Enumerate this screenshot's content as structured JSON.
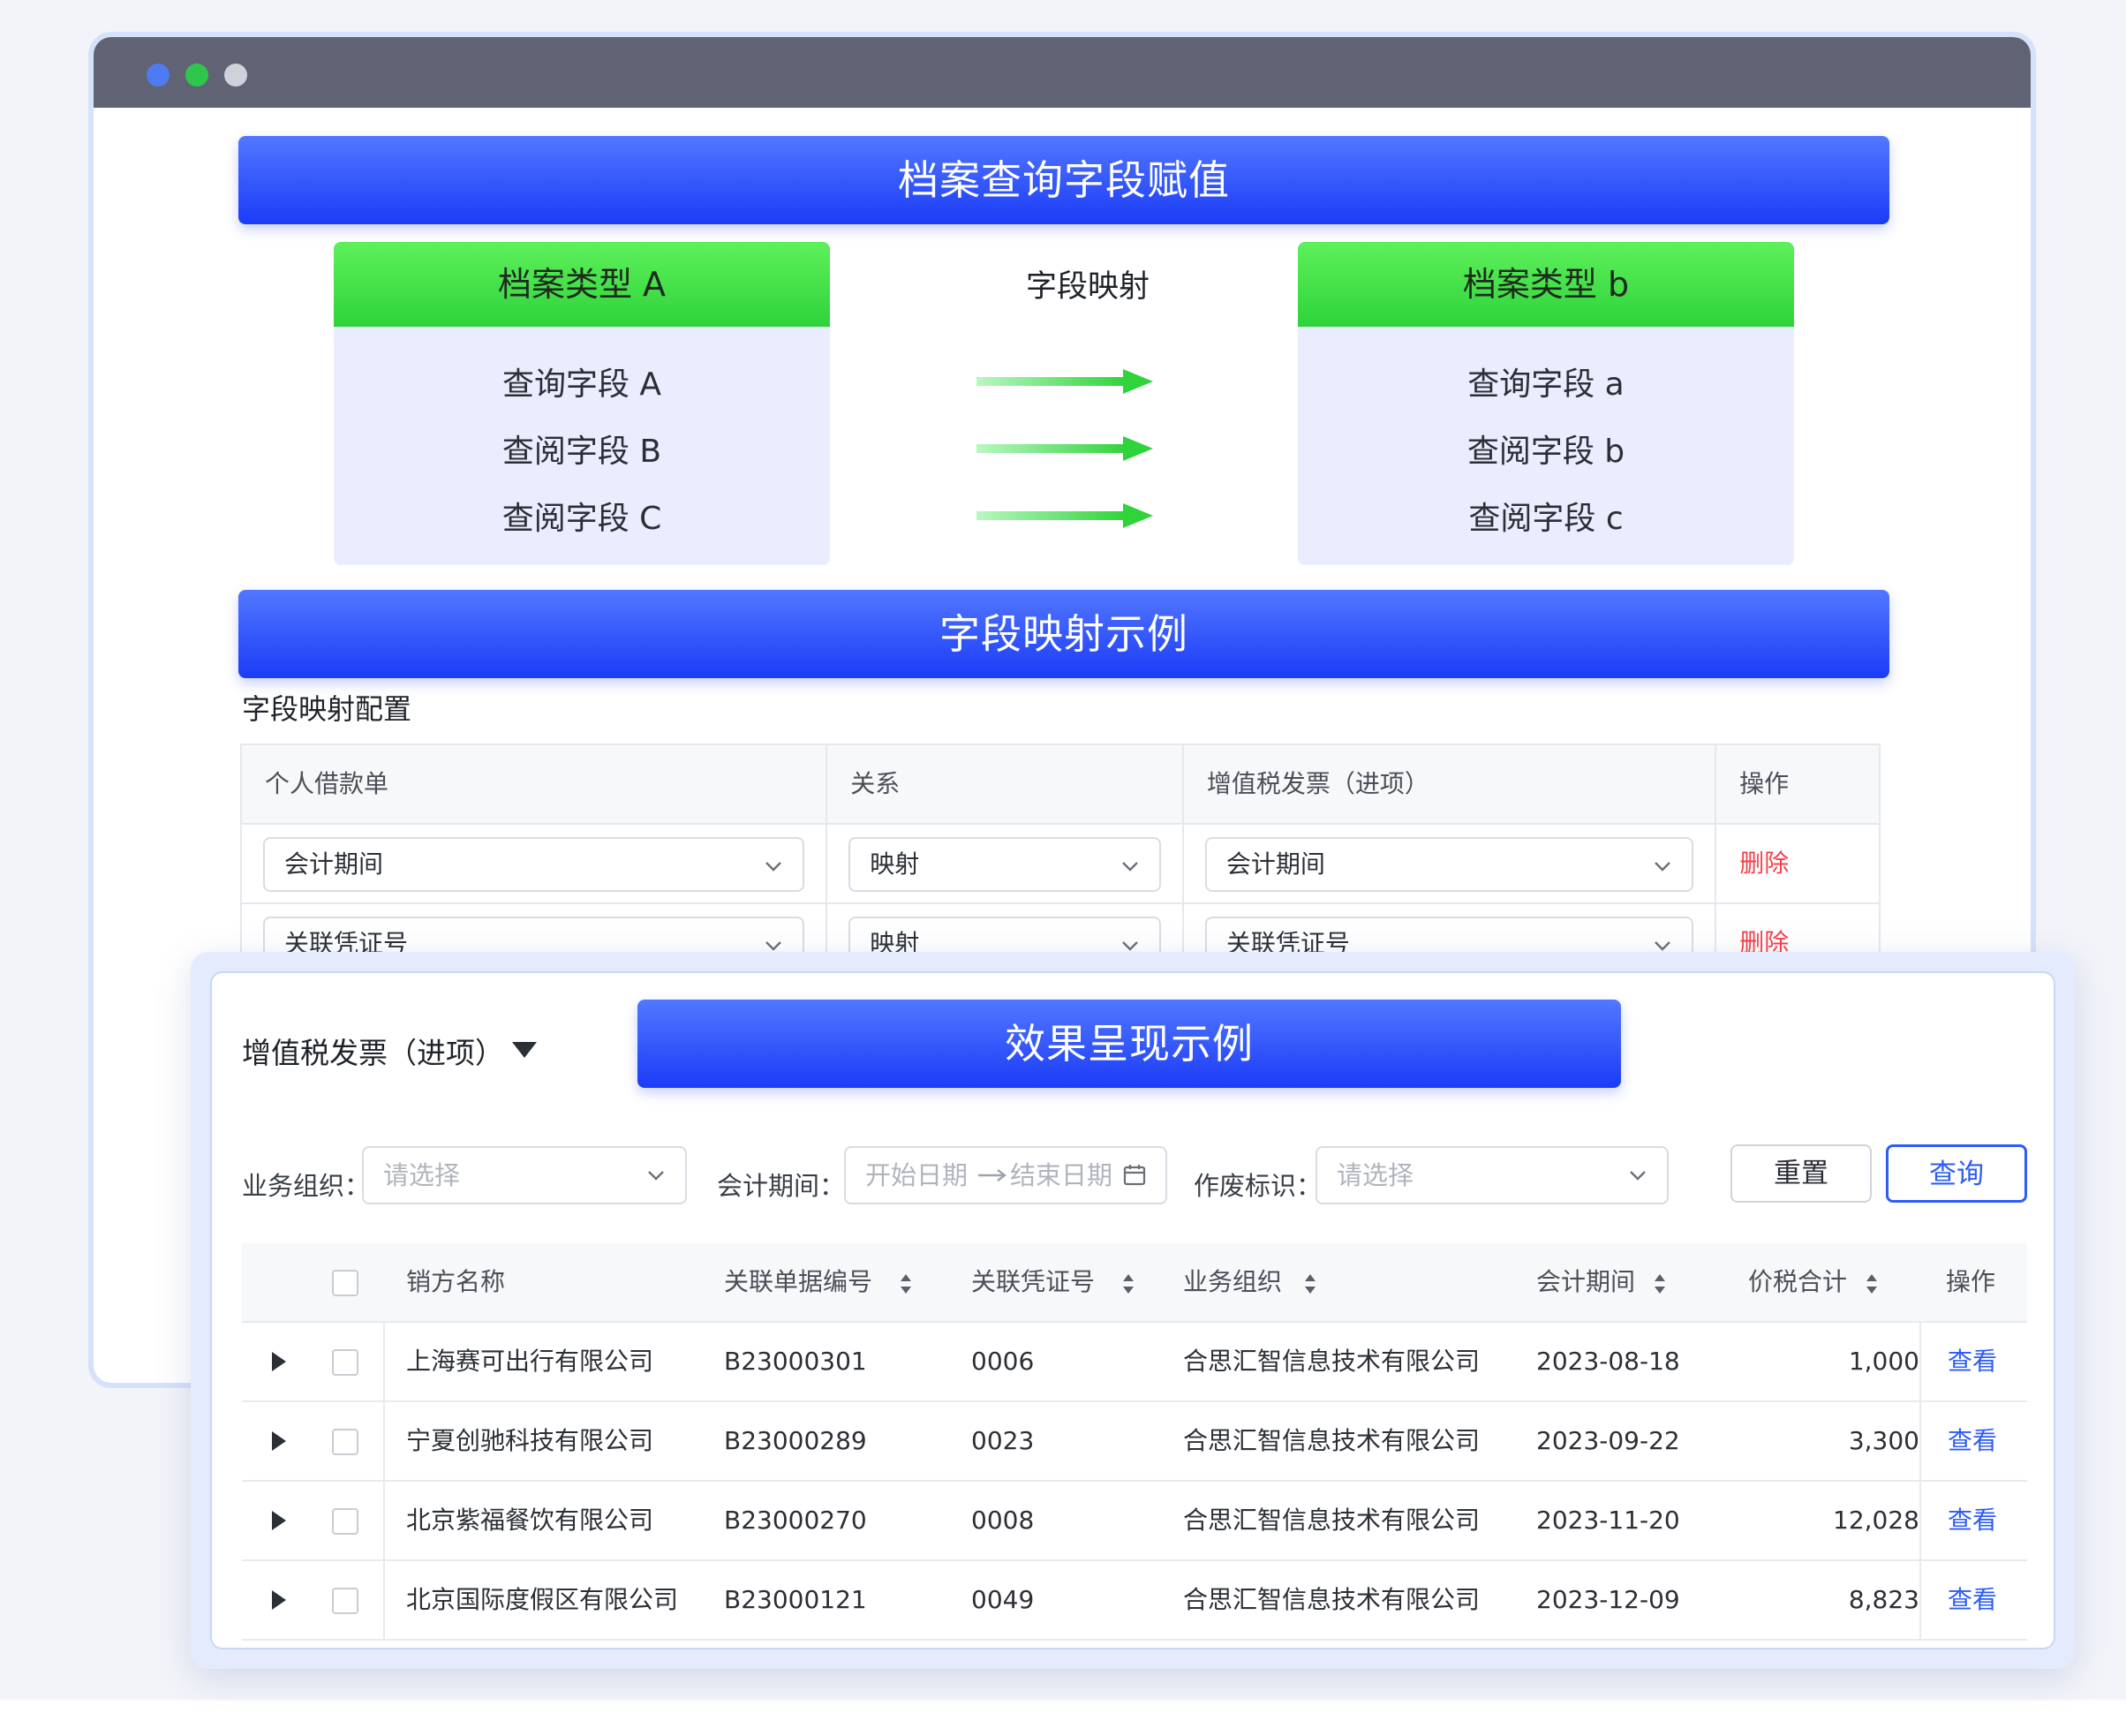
{
  "banners": {
    "mapping_title": "档案查询字段赋值",
    "example_title": "字段映射示例",
    "effect_title": "效果呈现示例"
  },
  "type_a": {
    "title": "档案类型 A",
    "fields": [
      "查询字段 A",
      "查阅字段 B",
      "查阅字段 C"
    ]
  },
  "type_b": {
    "title": "档案类型 b",
    "fields": [
      "查询字段 a",
      "查阅字段 b",
      "查阅字段 c"
    ]
  },
  "mapping_label": "字段映射",
  "config": {
    "title": "字段映射配置",
    "headers": [
      "个人借款单",
      "关系",
      "增值税发票（进项）",
      "操作"
    ],
    "rows": [
      {
        "source": "会计期间",
        "relation": "映射",
        "target": "会计期间",
        "action": "删除"
      },
      {
        "source": "关联凭证号",
        "relation": "映射",
        "target": "关联凭证号",
        "action": "删除"
      }
    ]
  },
  "effect": {
    "doc_type": "增值税发票（进项）",
    "filters": {
      "org_label": "业务组织：",
      "org_placeholder": "请选择",
      "period_label": "会计期间：",
      "start_placeholder": "开始日期",
      "end_placeholder": "结束日期",
      "void_label": "作废标识：",
      "void_placeholder": "请选择"
    },
    "buttons": {
      "reset": "重置",
      "query": "查询"
    },
    "table": {
      "headers": [
        "销方名称",
        "关联单据编号",
        "关联凭证号",
        "业务组织",
        "会计期间",
        "价税合计",
        "操作"
      ],
      "rows": [
        {
          "seller": "上海赛可出行有限公司",
          "doc_no": "B23000301",
          "voucher": "0006",
          "org": "合思汇智信息技术有限公司",
          "period": "2023-08-18",
          "total": "1,000",
          "action": "查看"
        },
        {
          "seller": "宁夏创驰科技有限公司",
          "doc_no": "B23000289",
          "voucher": "0023",
          "org": "合思汇智信息技术有限公司",
          "period": "2023-09-22",
          "total": "3,300",
          "action": "查看"
        },
        {
          "seller": "北京紫福餐饮有限公司",
          "doc_no": "B23000270",
          "voucher": "0008",
          "org": "合思汇智信息技术有限公司",
          "period": "2023-11-20",
          "total": "12,028",
          "action": "查看"
        },
        {
          "seller": "北京国际度假区有限公司",
          "doc_no": "B23000121",
          "voucher": "0049",
          "org": "合思汇智信息技术有限公司",
          "period": "2023-12-09",
          "total": "8,823",
          "action": "查看"
        }
      ]
    }
  },
  "colors": {
    "accent_blue": "#2d5cf6",
    "green_header": "#2fd33a",
    "delete_red": "#f5414a"
  }
}
